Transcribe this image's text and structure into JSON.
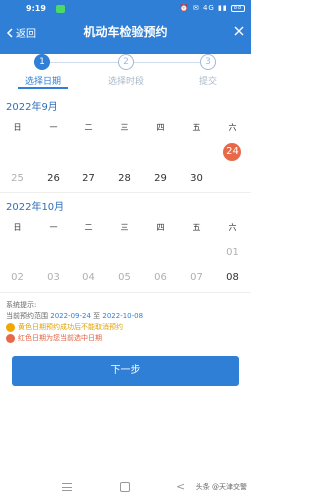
{
  "status_bar": {
    "time": "9:19",
    "right_icons": "⏰ ✉ 4G ▮▮",
    "battery": "88"
  },
  "header": {
    "back_label": "返回",
    "title": "机动车检验预约"
  },
  "steps": [
    {
      "number": "1",
      "label": "选择日期",
      "active": true
    },
    {
      "number": "2",
      "label": "选择时段",
      "active": false
    },
    {
      "number": "3",
      "label": "提交",
      "active": false
    }
  ],
  "weekdays": [
    "日",
    "一",
    "二",
    "三",
    "四",
    "五",
    "六"
  ],
  "calendar": [
    {
      "title": "2022年9月",
      "rows": [
        [
          "",
          "",
          "",
          "",
          "",
          "",
          "24"
        ],
        [
          "25",
          "26",
          "27",
          "28",
          "29",
          "30",
          ""
        ]
      ]
    },
    {
      "title": "2022年10月",
      "rows": [
        [
          "",
          "",
          "",
          "",
          "",
          "",
          "01"
        ],
        [
          "02",
          "03",
          "04",
          "05",
          "06",
          "07",
          "08"
        ]
      ]
    }
  ],
  "hints": {
    "title": "系统提示:",
    "range_prefix": "当前预约范围",
    "range_start": "2022-09-24",
    "range_mid": "至",
    "range_end": "2022-10-08",
    "legend_yellow": "黄色日期预约成功后不能取消预约",
    "legend_red": "红色日期为您当前选中日期"
  },
  "next_button": "下一步",
  "watermark": "头条 @天津交警",
  "colors": {
    "brand": "#2f7fd6",
    "selected": "#e8694a",
    "yellow": "#f0a800"
  }
}
